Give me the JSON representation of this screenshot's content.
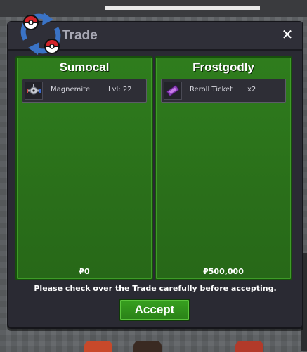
{
  "window": {
    "title": "Trade",
    "close_glyph": "✕"
  },
  "left_trader": {
    "name": "Sumocal",
    "item": {
      "icon": "magnemite-sprite-icon",
      "name": "Magnemite",
      "extra": "Lvl: 22"
    },
    "money": "₽0"
  },
  "right_trader": {
    "name": "Frostgodly",
    "item": {
      "icon": "reroll-ticket-icon",
      "name": "Reroll Ticket",
      "extra": "x2"
    },
    "money": "₽500,000"
  },
  "notice": "Please check over the Trade carefully before accepting.",
  "accept_label": "Accept",
  "colors": {
    "panel_green": "#2f7d1d",
    "window_bg": "#2a2a33",
    "accept_green": "#37a01f"
  }
}
